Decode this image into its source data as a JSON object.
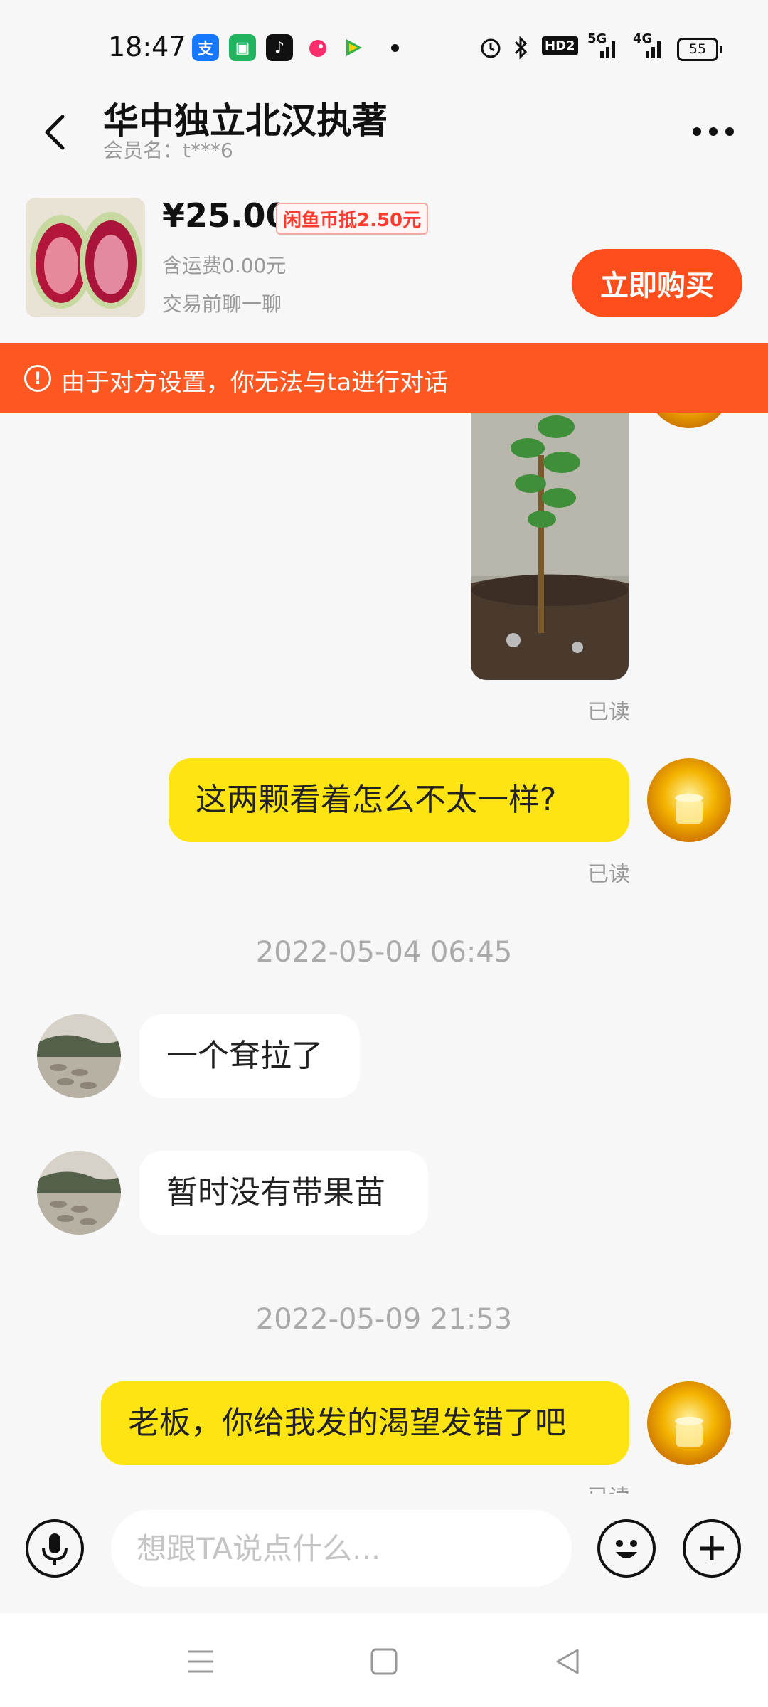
{
  "status_bar": {
    "time": "18:47",
    "hd_label": "HD2",
    "net1": "5G",
    "net2": "4G",
    "battery": "55"
  },
  "header": {
    "title": "华中独立北汉执著",
    "member": "会员名：t***6"
  },
  "product": {
    "price": "¥25.00",
    "coin_discount": "闲鱼币抵2.50元",
    "shipping": "含运费0.00元",
    "chat_before": "交易前聊一聊",
    "buy_label": "立即购买"
  },
  "notice": {
    "icon": "!",
    "text": "由于对方设置，你无法与ta进行对话"
  },
  "messages": {
    "read_1": "已读",
    "bubble_1": "这两颗看着怎么不太一样?",
    "read_2": "已读",
    "timestamp_1": "2022-05-04 06:45",
    "bubble_2": "一个耷拉了",
    "bubble_3": "暂时没有带果苗",
    "timestamp_2": "2022-05-09 21:53",
    "bubble_4": "老板，你给我发的渴望发错了吧",
    "read_3": "已读"
  },
  "input": {
    "placeholder": "想跟TA说点什么..."
  },
  "icons": {
    "back": "back-arrow-icon",
    "more": "more-icon",
    "mic": "microphone-icon",
    "emoji": "emoji-icon",
    "plus": "plus-icon",
    "nav_menu": "menu-icon",
    "nav_home": "home-icon",
    "nav_back": "back-triangle-icon"
  },
  "colors": {
    "accent": "#ff5722",
    "buy_button": "#ff4d1c",
    "my_bubble": "#ffe414",
    "price_badge": "#ff3b30"
  }
}
